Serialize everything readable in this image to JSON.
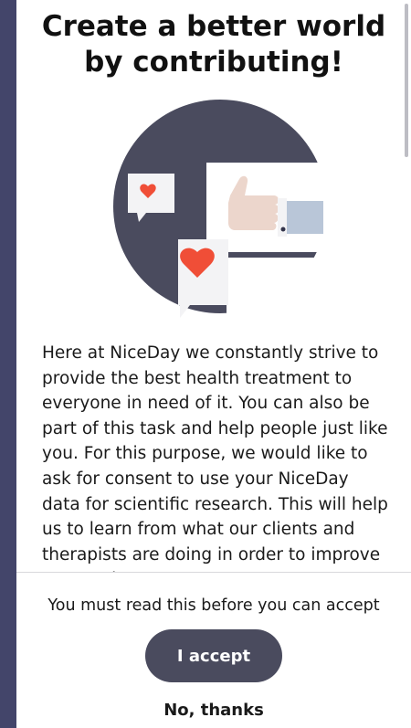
{
  "dialog": {
    "title_line1": "Create a better world",
    "title_line2": "by contributing!",
    "body": "Here at NiceDay we constantly strive to provide the best health treatment to everyone in need of it. You can also be part of this task and help people just like you. For this purpose, we would like to ask for consent to use your NiceDay data for scientific research. This will help us to learn from what our clients and therapists are doing in order to improve our service."
  },
  "footer": {
    "notice": "You must read this before you can accept",
    "accept_label": "I accept",
    "decline_label": "No, thanks"
  },
  "icons": {
    "illustration": "thumbs-up-hearts-illustration"
  },
  "colors": {
    "backdrop": "#43456a",
    "circle": "#4a4b5e",
    "heart": "#f04e37",
    "button": "#4a4b5e"
  }
}
